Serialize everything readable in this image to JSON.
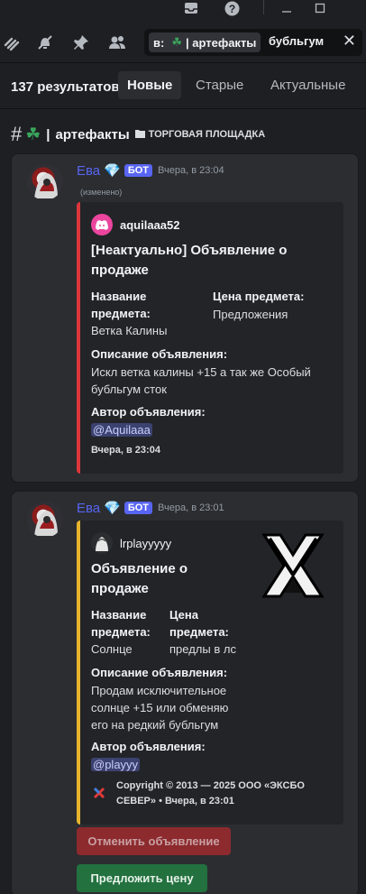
{
  "search": {
    "chip_prefix": "в:",
    "chip_channel": "| артефакты",
    "query": "бубльгум"
  },
  "results": {
    "count_text": "137 результатов",
    "tabs": [
      "Новые",
      "Старые",
      "Актуальные"
    ],
    "active_tab": "Новые"
  },
  "channel": {
    "name": "артефакты",
    "category": "ТОРГОВАЯ ПЛОЩАДКА"
  },
  "messages": [
    {
      "author": "Ева",
      "bot_tag": "БОТ",
      "timestamp": "Вчера, в 23:04",
      "edited": "(изменено)",
      "embed": {
        "accent_color": "#da373c",
        "author": "aquilaaa52",
        "title": "[Неактуально] Объявление о продаже",
        "fields": [
          {
            "name": "Название предмета:",
            "value": "Ветка Калины"
          },
          {
            "name": "Цена предмета:",
            "value": "Предложения"
          },
          {
            "name": "Описание объявления:",
            "value": "Искл ветка калины +15 а так же Особый бубльгум сток"
          },
          {
            "name": "Автор объявления:",
            "value": "@Aquilaaa"
          }
        ],
        "footer": "Вчера, в 23:04"
      }
    },
    {
      "author": "Ева",
      "bot_tag": "БОТ",
      "timestamp": "Вчера, в 23:01",
      "embed": {
        "accent_color": "#e5b32d",
        "author": "lrplayyyyy",
        "title": "Объявление о продаже",
        "fields": [
          {
            "name": "Название предмета:",
            "value": "Солнце"
          },
          {
            "name": "Цена предмета:",
            "value": "предлы в лс"
          },
          {
            "name": "Описание объявления:",
            "value": "Продам исключительное солнце +15 или обменяю его на редкий бубльгум"
          },
          {
            "name": "Автор объявления:",
            "value": "@playyy"
          }
        ],
        "footer": "Copyright © 2013 — 2025 ООО «ЭКСБО СЕВЕР» • Вчера, в 23:01"
      },
      "buttons": [
        {
          "label": "Отменить объявление",
          "color": "#8c2a2e"
        },
        {
          "label": "Предложить цену",
          "color": "#23713f"
        }
      ]
    }
  ],
  "colors": {
    "background": "#1e1f22",
    "card": "#2b2d31",
    "embed": "#232428",
    "bot_name": "#5865f2",
    "discord_blurple": "#5865f2"
  },
  "icons": {
    "window": [
      "inbox-icon",
      "help-icon",
      "minimize-icon",
      "maximize-icon"
    ],
    "toolbar": [
      "threads-icon",
      "mute-icon",
      "pin-icon",
      "members-icon"
    ]
  }
}
